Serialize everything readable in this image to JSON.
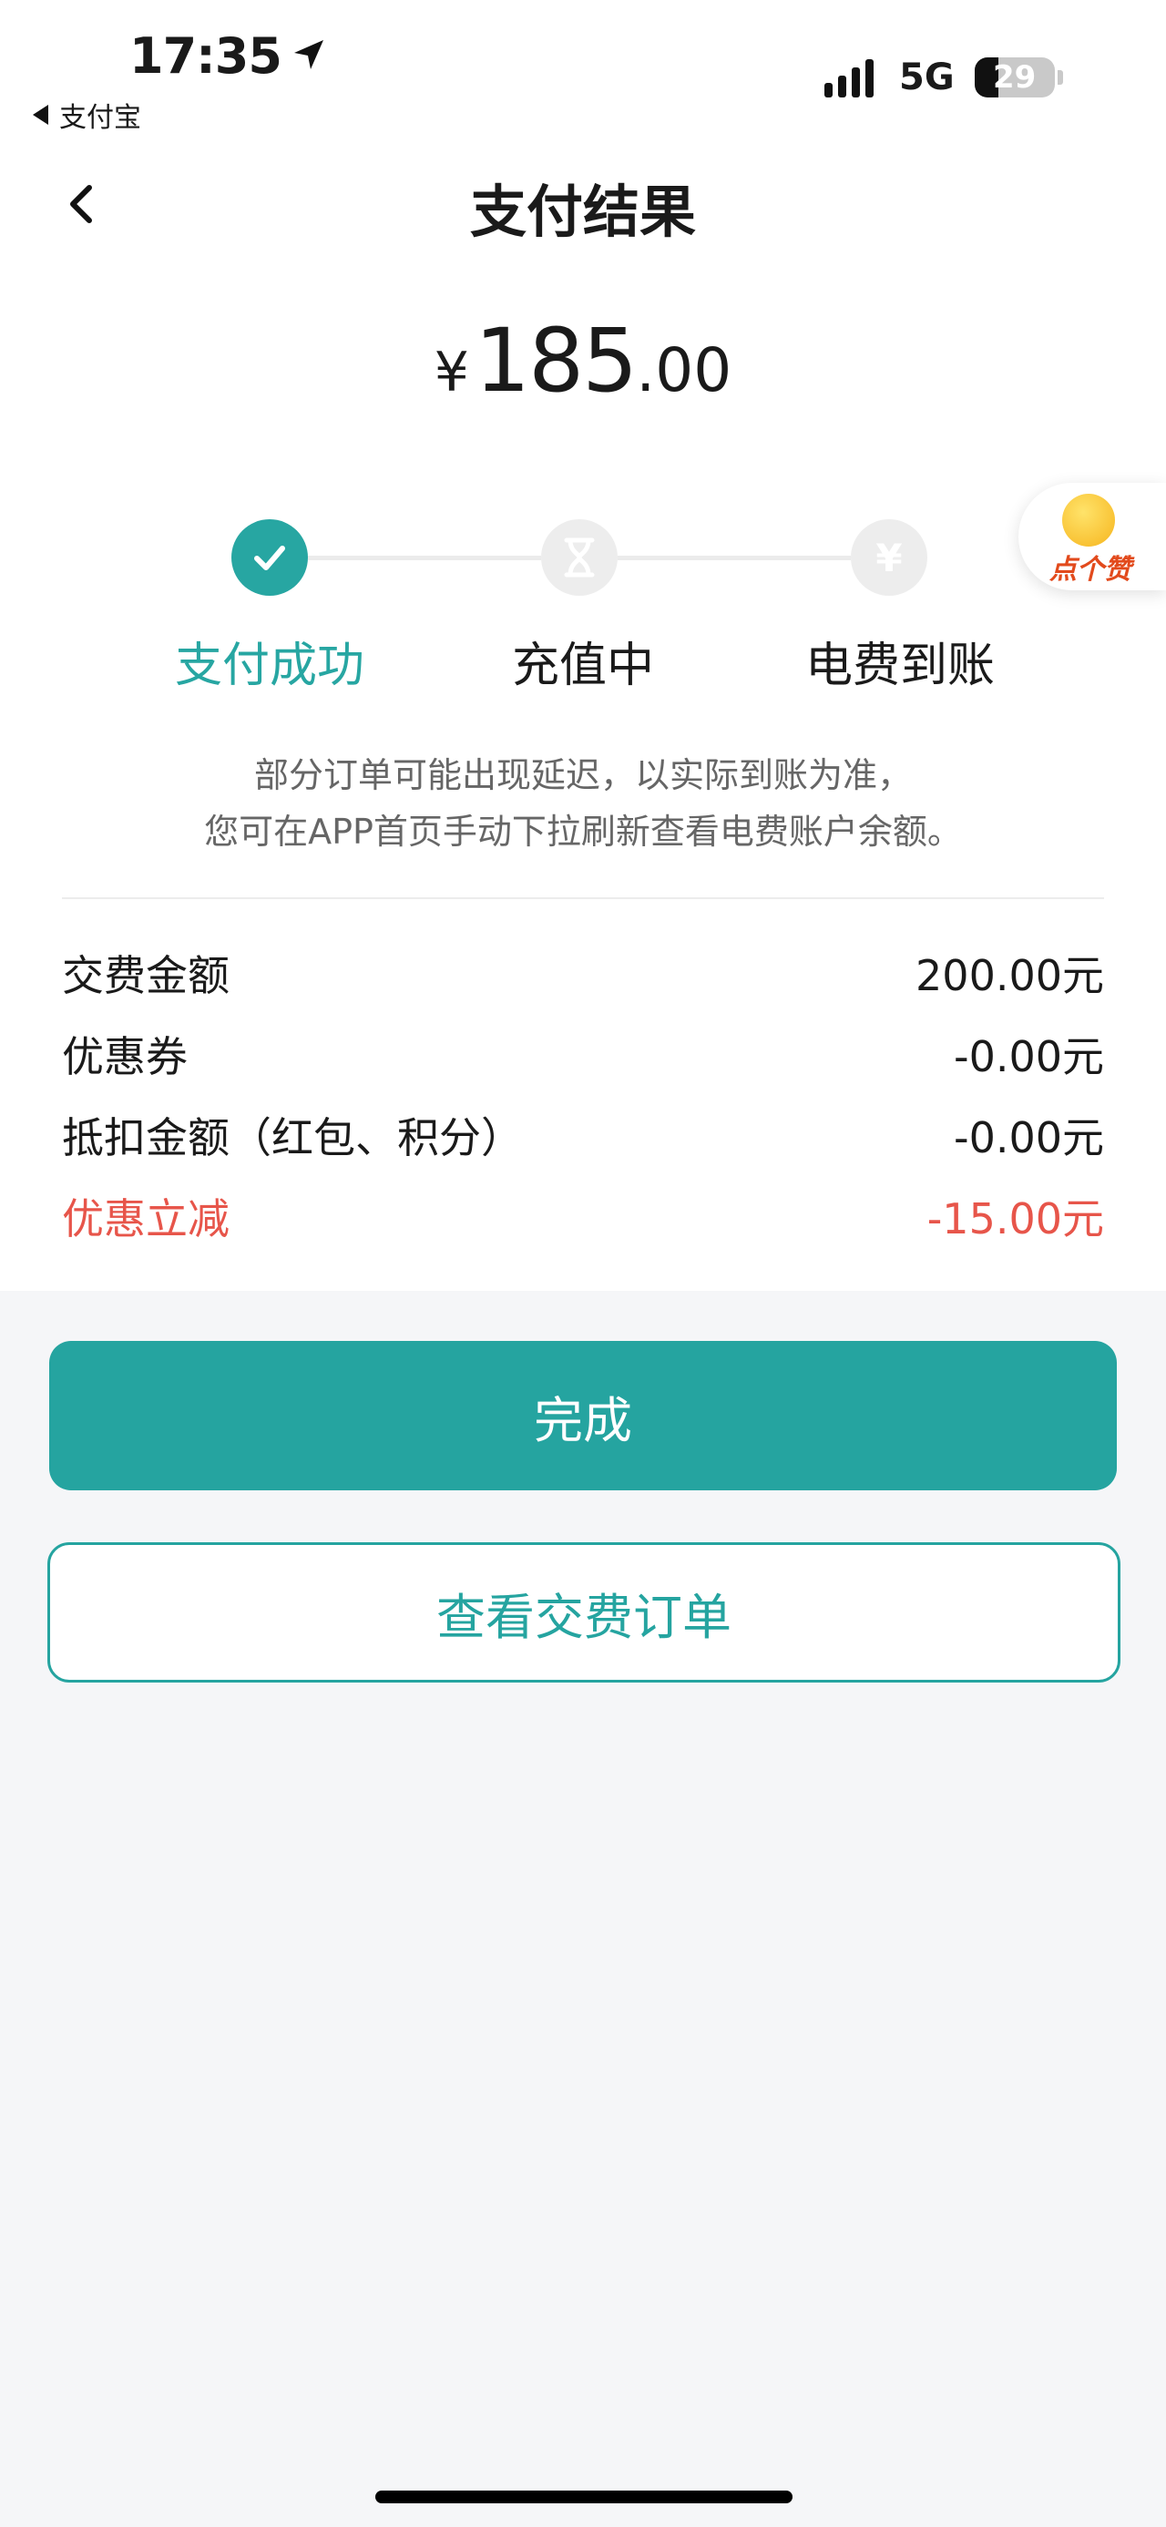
{
  "status_bar": {
    "time": "17:35",
    "back_app": "支付宝",
    "network": "5G",
    "battery": "29"
  },
  "header": {
    "title": "支付结果"
  },
  "amount": {
    "currency": "¥",
    "integer": "185",
    "decimal": ".00"
  },
  "steps": [
    {
      "label": "支付成功",
      "state": "done"
    },
    {
      "label": "充值中",
      "state": "pending",
      "icon": "hourglass-icon"
    },
    {
      "label": "电费到账",
      "state": "pending",
      "icon": "yen-icon",
      "glyph": "¥"
    }
  ],
  "like_widget": {
    "label": "点个赞"
  },
  "notice": {
    "line1": "部分订单可能出现延迟，以实际到账为准，",
    "line2": "您可在APP首页手动下拉刷新查看电费账户余额。"
  },
  "details": [
    {
      "label": "交费金额",
      "value": "200.00元"
    },
    {
      "label": "优惠券",
      "value": "-0.00元"
    },
    {
      "label": "抵扣金额（红包、积分）",
      "value": "-0.00元"
    },
    {
      "label": "优惠立减",
      "value": "-15.00元",
      "highlight": true
    }
  ],
  "buttons": {
    "done": "完成",
    "view_orders": "查看交费订单"
  },
  "colors": {
    "accent": "#25a4a0",
    "discount_red": "#e7554a"
  }
}
